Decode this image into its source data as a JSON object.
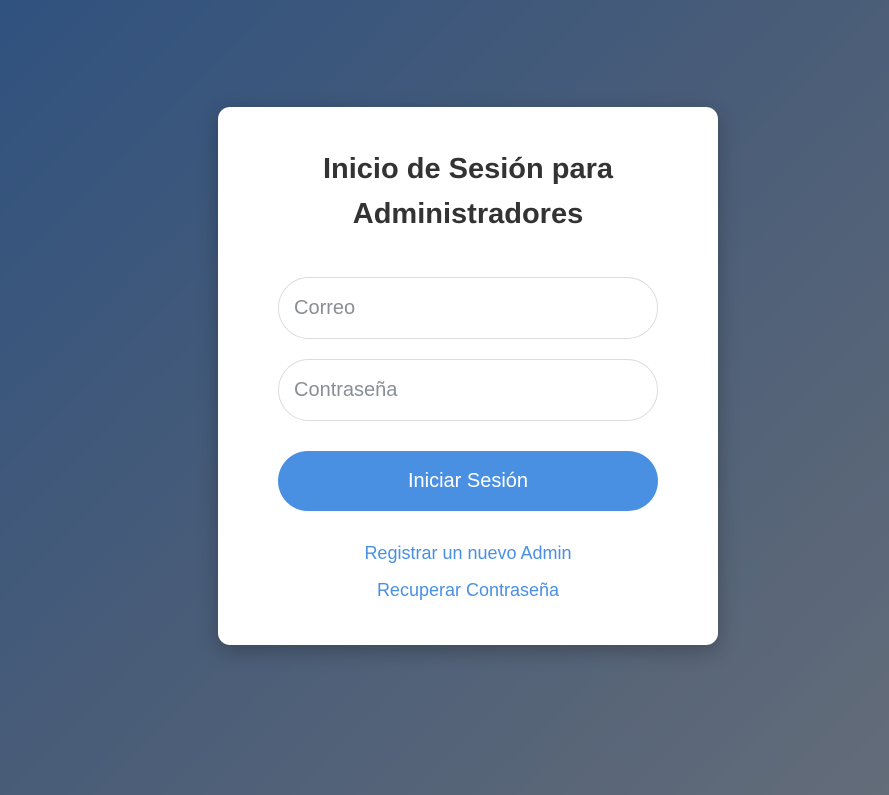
{
  "login": {
    "title_line1": "Inicio de Sesión para",
    "title_line2": "Administradores",
    "email_placeholder": "Correo",
    "email_value": "",
    "password_placeholder": "Contraseña",
    "password_value": "",
    "submit_label": "Iniciar Sesión",
    "register_link": "Registrar un nuevo Admin",
    "recover_link": "Recuperar Contraseña"
  },
  "colors": {
    "accent": "#4a90e2",
    "title_text": "#333333",
    "card_background": "#ffffff",
    "page_gradient_start": "#30527f",
    "page_gradient_end": "#636c79"
  }
}
